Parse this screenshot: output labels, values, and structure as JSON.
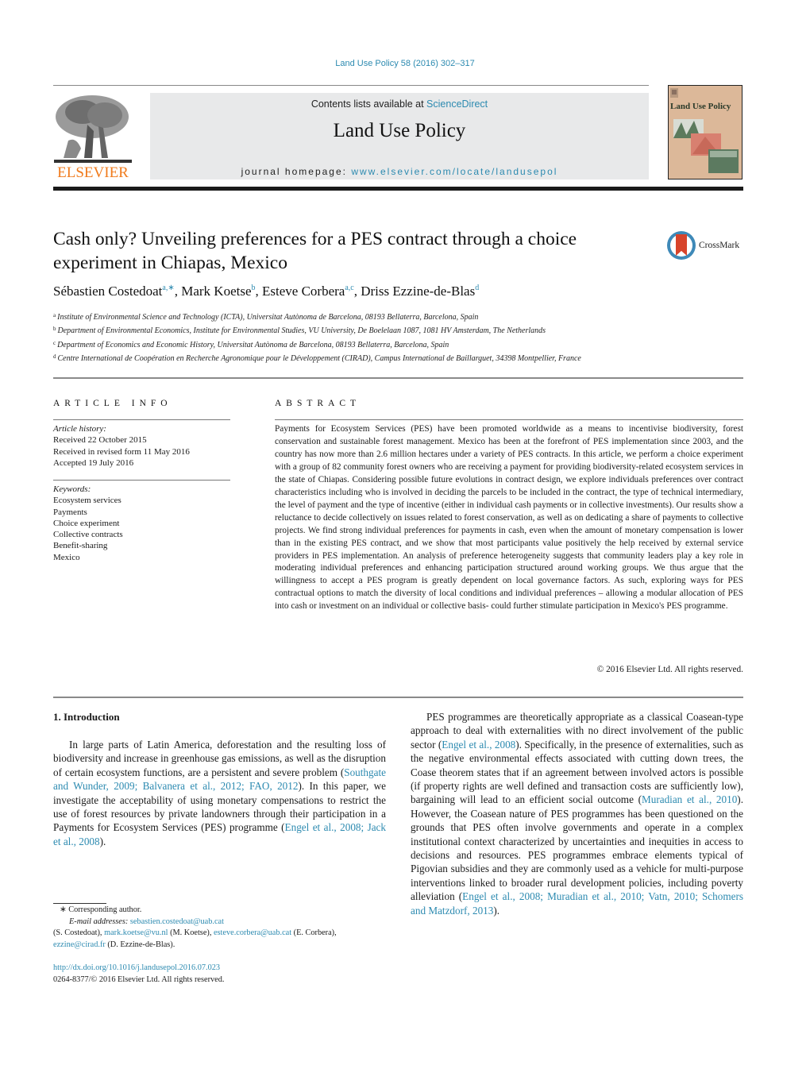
{
  "header": {
    "journal_ref": "Land Use Policy 58 (2016) 302–317",
    "contents_prefix": "Contents lists available at ",
    "contents_link": "ScienceDirect",
    "journal_title": "Land Use Policy",
    "homepage_prefix": "journal homepage: ",
    "homepage_link": "www.elsevier.com/locate/landusepol",
    "publisher_logo_text": "ELSEVIER",
    "cover_title": "Land Use Policy"
  },
  "colors": {
    "link": "#2c8ab0",
    "elsevier_orange": "#f07b1d",
    "banner_bg": "#e8e9ea",
    "cover_bg": "#dcb899"
  },
  "article": {
    "title": "Cash only? Unveiling preferences for a PES contract through a choice experiment in Chiapas, Mexico",
    "crossmark_label": "CrossMark",
    "authors": [
      {
        "name": "Sébastien Costedoat",
        "sup": "a,∗",
        "sep": ", "
      },
      {
        "name": "Mark Koetse",
        "sup": "b",
        "sep": ", "
      },
      {
        "name": "Esteve Corbera",
        "sup": "a,c",
        "sep": ", "
      },
      {
        "name": "Driss Ezzine-de-Blas",
        "sup": "d",
        "sep": ""
      }
    ],
    "affiliations": [
      {
        "key": "a",
        "text": "Institute of Environmental Science and Technology (ICTA), Universitat Autònoma de Barcelona, 08193 Bellaterra, Barcelona, Spain"
      },
      {
        "key": "b",
        "text": "Department of Environmental Economics, Institute for Environmental Studies, VU University, De Boelelaan 1087, 1081 HV Amsterdam, The Netherlands"
      },
      {
        "key": "c",
        "text": "Department of Economics and Economic History, Universitat Autònoma de Barcelona, 08193 Bellaterra, Barcelona, Spain"
      },
      {
        "key": "d",
        "text": "Centre International de Coopération en Recherche Agronomique pour le Développement (CIRAD), Campus International de Baillarguet, 34398 Montpellier, France"
      }
    ]
  },
  "article_info": {
    "label": "ARTICLE INFO",
    "history_label": "Article history:",
    "history": [
      "Received 22 October 2015",
      "Received in revised form 11 May 2016",
      "Accepted 19 July 2016"
    ],
    "keywords_label": "Keywords:",
    "keywords": [
      "Ecosystem services",
      "Payments",
      "Choice experiment",
      "Collective contracts",
      "Benefit-sharing",
      "Mexico"
    ]
  },
  "abstract": {
    "label": "ABSTRACT",
    "text": "Payments for Ecosystem Services (PES) have been promoted worldwide as a means to incentivise biodiversity, forest conservation and sustainable forest management. Mexico has been at the forefront of PES implementation since 2003, and the country has now more than 2.6 million hectares under a variety of PES contracts. In this article, we perform a choice experiment with a group of 82 community forest owners who are receiving a payment for providing biodiversity-related ecosystem services in the state of Chiapas. Considering possible future evolutions in contract design, we explore individuals preferences over contract characteristics including who is involved in deciding the parcels to be included in the contract, the type of technical intermediary, the level of payment and the type of incentive (either in individual cash payments or in collective investments). Our results show a reluctance to decide collectively on issues related to forest conservation, as well as on dedicating a share of payments to collective projects. We find strong individual preferences for payments in cash, even when the amount of monetary compensation is lower than in the existing PES contract, and we show that most participants value positively the help received by external service providers in PES implementation. An analysis of preference heterogeneity suggests that community leaders play a key role in moderating individual preferences and enhancing participation structured around working groups. We thus argue that the willingness to accept a PES program is greatly dependent on local governance factors. As such, exploring ways for PES contractual options to match the diversity of local conditions and individual preferences – allowing a modular allocation of PES into cash or investment on an individual or collective basis- could further stimulate participation in Mexico's PES programme.",
    "copyright": "© 2016 Elsevier Ltd. All rights reserved."
  },
  "body": {
    "section_heading": "1.  Introduction",
    "intro_p1": [
      {
        "t": "In large parts of Latin America, deforestation and the resulting loss of biodiversity and increase in greenhouse gas emissions, as well as the disruption of certain ecosystem functions, are a persistent and severe problem ("
      },
      {
        "t": "Southgate and Wunder, 2009; Balvanera et al., 2012; FAO, 2012",
        "link": true
      },
      {
        "t": "). In this paper, we investigate the acceptability of using monetary compensations to restrict the use of forest resources by private landowners through their participation in a Payments for Ecosystem Services (PES) programme ("
      },
      {
        "t": "Engel et al., 2008; Jack et al., 2008",
        "link": true
      },
      {
        "t": ")."
      }
    ],
    "intro_p2": [
      {
        "t": "PES programmes are theoretically appropriate as a classical Coasean-type approach to deal with externalities with no direct involvement of the public sector ("
      },
      {
        "t": "Engel et al., 2008",
        "link": true
      },
      {
        "t": "). Specifically, in the presence of externalities, such as the negative environmental effects associated with cutting down trees, the Coase theorem states that if an agreement between involved actors is possible (if property rights are well defined and transaction costs are sufficiently low), bargaining will lead to an efficient social outcome ("
      },
      {
        "t": "Muradian et al., 2010",
        "link": true
      },
      {
        "t": "). However, the Coasean nature of PES programmes has been questioned on the grounds that PES often involve governments and operate in a complex institutional context characterized by uncertainties and inequities in access to decisions and resources. PES programmes embrace elements typical of Pigovian subsidies and they are commonly used as a vehicle for multi-purpose interventions linked to broader rural development policies, including poverty alleviation ("
      },
      {
        "t": "Engel et al., 2008; Muradian et al., 2010; Vatn, 2010; Schomers and Matzdorf, 2013",
        "link": true
      },
      {
        "t": ")."
      }
    ]
  },
  "footnotes": {
    "corresponding": "∗  Corresponding author.",
    "email_label": "E-mail addresses:",
    "emails": [
      {
        "email": "sebastien.costedoat@uab.cat",
        "who": "(S. Costedoat)"
      },
      {
        "email": "mark.koetse@vu.nl",
        "who": "(M. Koetse)"
      },
      {
        "email": "esteve.corbera@uab.cat",
        "who": "(E. Corbera)"
      },
      {
        "email": "ezzine@cirad.fr",
        "who": "(D. Ezzine-de-Blas)."
      }
    ],
    "doi": "http://dx.doi.org/10.1016/j.landusepol.2016.07.023",
    "issn_line": "0264-8377/© 2016 Elsevier Ltd. All rights reserved."
  }
}
